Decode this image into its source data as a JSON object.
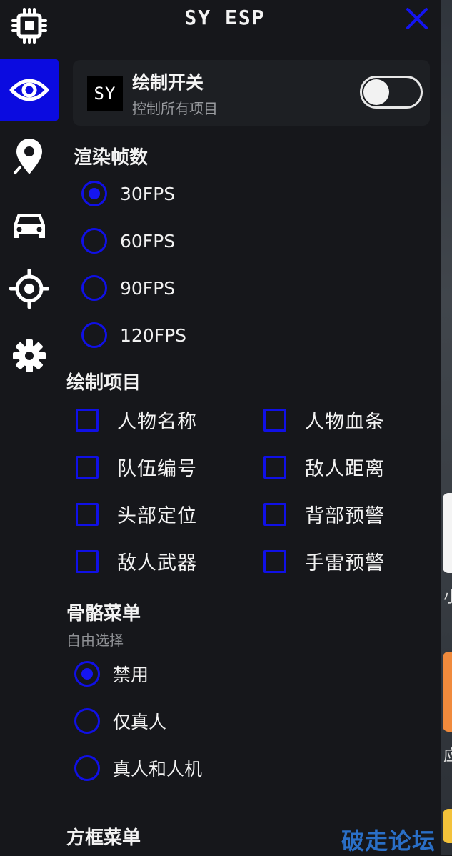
{
  "app": {
    "title": "SY ESP"
  },
  "sidebar": {
    "items": [
      {
        "icon": "chip-icon",
        "active": false
      },
      {
        "icon": "eye-icon",
        "active": true
      },
      {
        "icon": "location-pin-icon",
        "active": false
      },
      {
        "icon": "car-icon",
        "active": false
      },
      {
        "icon": "crosshair-icon",
        "active": false
      },
      {
        "icon": "gear-icon",
        "active": false
      }
    ]
  },
  "master_switch": {
    "logo": "SY",
    "title": "绘制开关",
    "subtitle": "控制所有项目",
    "enabled": false
  },
  "fps": {
    "title": "渲染帧数",
    "options": [
      "30FPS",
      "60FPS",
      "90FPS",
      "120FPS"
    ],
    "selected": "30FPS"
  },
  "draw_items": {
    "title": "绘制项目",
    "left": [
      "人物名称",
      "队伍编号",
      "头部定位",
      "敌人武器"
    ],
    "right": [
      "人物血条",
      "敌人距离",
      "背部预警",
      "手雷预警"
    ]
  },
  "skeleton": {
    "title": "骨骼菜单",
    "subtitle": "自由选择",
    "options": [
      "禁用",
      "仅真人",
      "真人和人机"
    ],
    "selected": "禁用"
  },
  "box_menu": {
    "title": "方框菜单"
  },
  "backdrop": {
    "text1": "小",
    "text2": "应"
  },
  "watermark": "破走论坛",
  "colors": {
    "accent": "#1010E6",
    "panel": "#16171B",
    "watermark": "#2A6FC7"
  }
}
